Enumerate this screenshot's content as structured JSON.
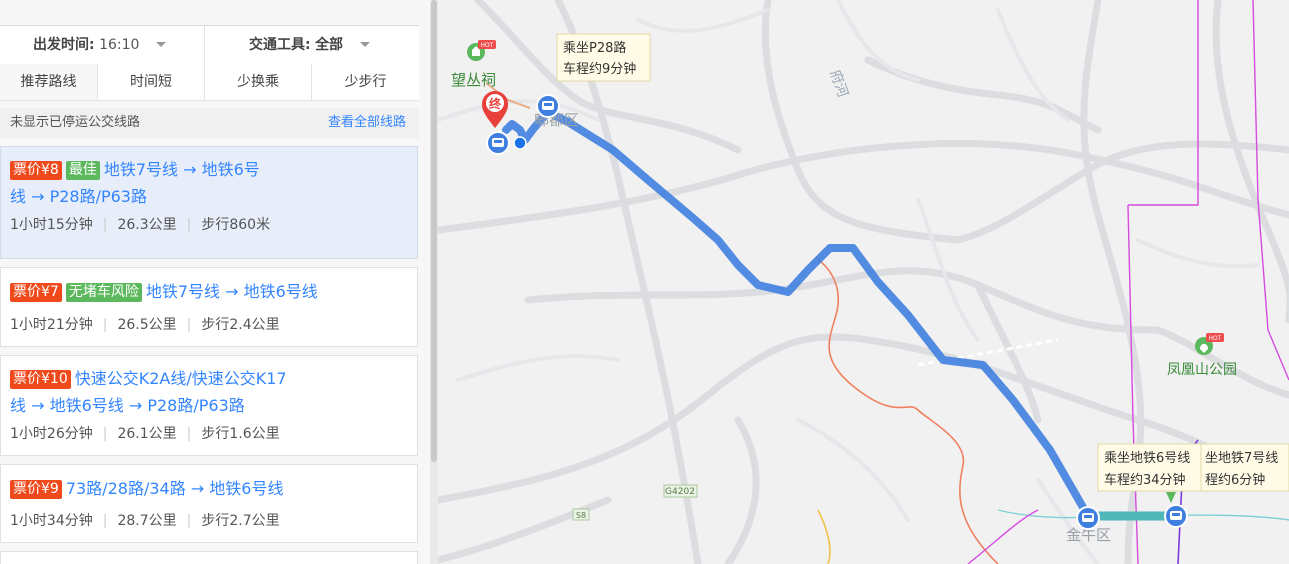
{
  "filters": {
    "departure_label": "出发时间:",
    "departure_value": "16:10",
    "transport_label": "交通工具:",
    "transport_value": "全部"
  },
  "tabs": [
    "推荐路线",
    "时间短",
    "少换乘",
    "少步行"
  ],
  "notice": {
    "text": "未显示已停运公交线路",
    "link": "查看全部线路"
  },
  "routes": [
    {
      "price": "票价¥8",
      "tag": "最佳",
      "line1": "地铁7号线 → 地铁6号",
      "line2": "线 → P28路/P63路",
      "duration": "1小时15分钟",
      "distance": "26.3公里",
      "walk": "步行860米"
    },
    {
      "price": "票价¥7",
      "tag": "无堵车风险",
      "line1": "地铁7号线 → 地铁6号线",
      "line2": "",
      "duration": "1小时21分钟",
      "distance": "26.5公里",
      "walk": "步行2.4公里"
    },
    {
      "price": "票价¥10",
      "tag": "",
      "line1": "快速公交K2A线/快速公交K17",
      "line2": "线 → 地铁6号线 → P28路/P63路",
      "duration": "1小时26分钟",
      "distance": "26.1公里",
      "walk": "步行1.6公里"
    },
    {
      "price": "票价¥9",
      "tag": "",
      "line1": "73路/28路/34路 → 地铁6号线",
      "line2": "",
      "duration": "1小时34分钟",
      "distance": "28.7公里",
      "walk": "步行2.7公里"
    }
  ],
  "map": {
    "poi_wangcongci": "望丛祠",
    "poi_hot": "HOT",
    "poi_fenghuangshan": "凤凰山公园",
    "end_marker": "终",
    "district_pidu": "郫都区",
    "district_jinniu": "金牛区",
    "river_label": "府河",
    "road_g4202": "G4202",
    "road_s8": "S8",
    "tooltip_p28_line1": "乘坐P28路",
    "tooltip_p28_line2": "车程约9分钟",
    "tooltip_m6_line1": "乘坐地铁6号线",
    "tooltip_m6_line2": "车程约34分钟",
    "tooltip_m7_line1": "坐地铁7号线",
    "tooltip_m7_line2": "程约6分钟",
    "route_color": "#4f8de8",
    "metro_color": "#4fb7b7"
  }
}
